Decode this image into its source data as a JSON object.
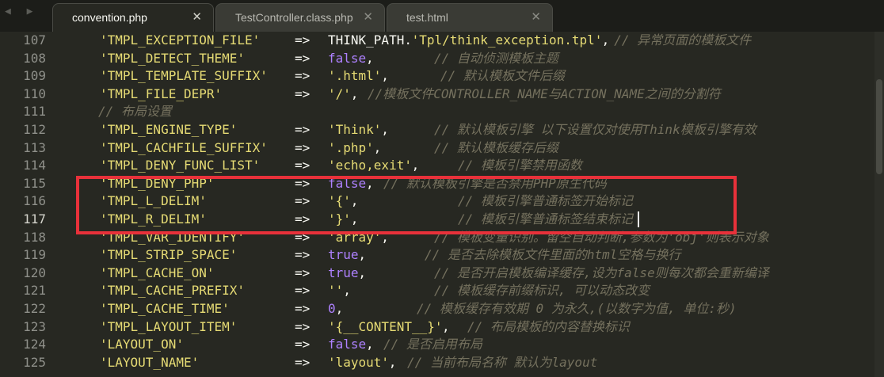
{
  "tabs": [
    {
      "label": "convention.php",
      "active": true
    },
    {
      "label": "TestController.class.php",
      "active": false
    },
    {
      "label": "test.html",
      "active": false
    }
  ],
  "close_glyph": "✕",
  "nav_glyph": "◀ ▶",
  "current_line": "117",
  "annotation_color": "#e8313a",
  "lines": [
    {
      "n": "107",
      "key": "'TMPL_EXCEPTION_FILE'",
      "op": "=>",
      "segs": [
        {
          "t": "THINK_PATH.",
          "c": "pl"
        },
        {
          "t": "'Tpl/think_exception.tpl'",
          "c": "val"
        },
        {
          "t": ",",
          "c": "pl"
        },
        {
          "t": "// 异常页面的模板文件",
          "c": "cm"
        }
      ]
    },
    {
      "n": "108",
      "key": "'TMPL_DETECT_THEME'",
      "op": "=>",
      "segs": [
        {
          "t": "false",
          "c": "kw"
        },
        {
          "t": ",",
          "c": "pl"
        },
        {
          "t": "// 自动侦测模板主题",
          "c": "cm"
        }
      ]
    },
    {
      "n": "109",
      "key": "'TMPL_TEMPLATE_SUFFIX'",
      "op": "=>",
      "segs": [
        {
          "t": "'.html'",
          "c": "val"
        },
        {
          "t": ",",
          "c": "pl"
        },
        {
          "t": "// 默认模板文件后缀",
          "c": "cm"
        }
      ]
    },
    {
      "n": "110",
      "key": "'TMPL_FILE_DEPR'",
      "op": "=>",
      "segs": [
        {
          "t": "'/'",
          "c": "val"
        },
        {
          "t": ",",
          "c": "pl"
        },
        {
          "t": "//模板文件CONTROLLER_NAME与ACTION_NAME之间的分割符",
          "c": "cm"
        }
      ]
    },
    {
      "n": "111",
      "key": "",
      "op": "",
      "segs": [
        {
          "t": "// 布局设置",
          "c": "cm"
        }
      ]
    },
    {
      "n": "112",
      "key": "'TMPL_ENGINE_TYPE'",
      "op": "=>",
      "segs": [
        {
          "t": "'Think'",
          "c": "val"
        },
        {
          "t": ",",
          "c": "pl"
        },
        {
          "t": "// 默认模板引擎 以下设置仅对使用Think模板引擎有效",
          "c": "cm"
        }
      ]
    },
    {
      "n": "113",
      "key": "'TMPL_CACHFILE_SUFFIX'",
      "op": "=>",
      "segs": [
        {
          "t": "'.php'",
          "c": "val"
        },
        {
          "t": ",",
          "c": "pl"
        },
        {
          "t": "// 默认模板缓存后缀",
          "c": "cm"
        }
      ]
    },
    {
      "n": "114",
      "key": "'TMPL_DENY_FUNC_LIST'",
      "op": "=>",
      "segs": [
        {
          "t": "'echo,exit'",
          "c": "val"
        },
        {
          "t": ",",
          "c": "pl"
        },
        {
          "t": "// 模板引擎禁用函数",
          "c": "cm"
        }
      ]
    },
    {
      "n": "115",
      "key": "'TMPL_DENY_PHP'",
      "op": "=>",
      "segs": [
        {
          "t": "false",
          "c": "kw"
        },
        {
          "t": ",",
          "c": "pl"
        },
        {
          "t": "// 默认模板引擎是否禁用PHP原生代码",
          "c": "cm"
        }
      ]
    },
    {
      "n": "116",
      "key": "'TMPL_L_DELIM'",
      "op": "=>",
      "segs": [
        {
          "t": "'{'",
          "c": "val"
        },
        {
          "t": ",",
          "c": "pl"
        },
        {
          "t": "// 模板引擎普通标签开始标记",
          "c": "cm"
        }
      ]
    },
    {
      "n": "117",
      "key": "'TMPL_R_DELIM'",
      "op": "=>",
      "segs": [
        {
          "t": "'}'",
          "c": "val"
        },
        {
          "t": ",",
          "c": "pl"
        },
        {
          "t": "// 模板引擎普通标签结束标记",
          "c": "cm"
        }
      ]
    },
    {
      "n": "118",
      "key": "'TMPL_VAR_IDENTIFY'",
      "op": "=>",
      "segs": [
        {
          "t": "'array'",
          "c": "val"
        },
        {
          "t": ",",
          "c": "pl"
        },
        {
          "t": "// 模板变量识别。留空自动判断,参数为'obj'则表示对象",
          "c": "cm"
        }
      ]
    },
    {
      "n": "119",
      "key": "'TMPL_STRIP_SPACE'",
      "op": "=>",
      "segs": [
        {
          "t": "true",
          "c": "kw"
        },
        {
          "t": ",",
          "c": "pl"
        },
        {
          "t": "// 是否去除模板文件里面的html空格与换行",
          "c": "cm"
        }
      ]
    },
    {
      "n": "120",
      "key": "'TMPL_CACHE_ON'",
      "op": "=>",
      "segs": [
        {
          "t": "true",
          "c": "kw"
        },
        {
          "t": ",",
          "c": "pl"
        },
        {
          "t": "// 是否开启模板编译缓存,设为false则每次都会重新编译",
          "c": "cm"
        }
      ]
    },
    {
      "n": "121",
      "key": "'TMPL_CACHE_PREFIX'",
      "op": "=>",
      "segs": [
        {
          "t": "''",
          "c": "val"
        },
        {
          "t": ",",
          "c": "pl"
        },
        {
          "t": "// 模板缓存前缀标识, 可以动态改变",
          "c": "cm"
        }
      ]
    },
    {
      "n": "122",
      "key": "'TMPL_CACHE_TIME'",
      "op": "=>",
      "segs": [
        {
          "t": "0",
          "c": "kw"
        },
        {
          "t": ",",
          "c": "pl"
        },
        {
          "t": "// 模板缓存有效期 0 为永久,(以数字为值, 单位:秒)",
          "c": "cm"
        }
      ]
    },
    {
      "n": "123",
      "key": "'TMPL_LAYOUT_ITEM'",
      "op": "=>",
      "segs": [
        {
          "t": "'{__CONTENT__}'",
          "c": "val"
        },
        {
          "t": ",",
          "c": "pl"
        },
        {
          "t": "// 布局模板的内容替换标识",
          "c": "cm"
        }
      ]
    },
    {
      "n": "124",
      "key": "'LAYOUT_ON'",
      "op": "=>",
      "segs": [
        {
          "t": "false",
          "c": "kw"
        },
        {
          "t": ",",
          "c": "pl"
        },
        {
          "t": "// 是否启用布局",
          "c": "cm"
        }
      ]
    },
    {
      "n": "125",
      "key": "'LAYOUT_NAME'",
      "op": "=>",
      "segs": [
        {
          "t": "'layout'",
          "c": "val"
        },
        {
          "t": ",",
          "c": "pl"
        },
        {
          "t": "// 当前布局名称 默认为layout",
          "c": "cm"
        }
      ]
    }
  ]
}
